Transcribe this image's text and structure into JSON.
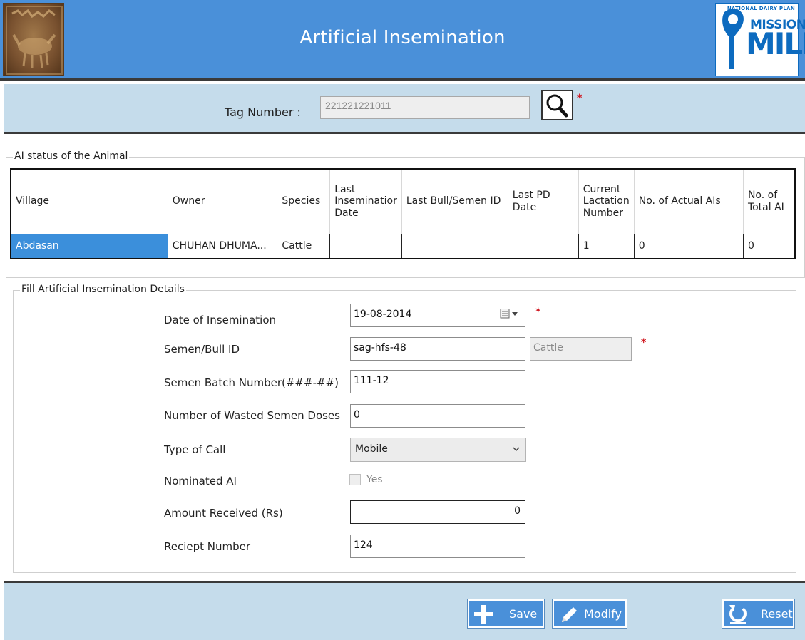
{
  "header": {
    "title": "Artificial Insemination",
    "logo_right": {
      "plan": "NATIONAL DAIRY PLAN",
      "mission": "MISSION",
      "milk": "MILK"
    }
  },
  "tag": {
    "label": "Tag Number :",
    "value": "221221221011"
  },
  "ai_status": {
    "legend": "AI status of the Animal",
    "columns": [
      "Village",
      "Owner",
      "Species",
      "Last Inseminatior Date",
      "Last Bull/Semen ID",
      "Last PD Date",
      "Current Lactation Number",
      "No. of Actual AIs",
      "No. of Total AI"
    ],
    "row": {
      "village": "Abdasan",
      "owner": "CHUHAN   DHUMA...",
      "species": "Cattle",
      "last_insemination_date": "",
      "last_bull_semen_id": "",
      "last_pd_date": "",
      "current_lactation_number": "1",
      "actual_ais": "0",
      "total_ai": "0"
    }
  },
  "details": {
    "legend": "Fill Artificial Insemination Details",
    "date_label": "Date of Insemination",
    "date_value": "19-08-2014",
    "semen_label": "Semen/Bull ID",
    "semen_value": "sag-hfs-48",
    "species_value": "Cattle",
    "batch_label": "Semen Batch Number(###-##)",
    "batch_value": "111-12",
    "wasted_label": "Number of Wasted Semen Doses",
    "wasted_value": "0",
    "call_label": "Type of Call",
    "call_value": "Mobile",
    "nominated_label": "Nominated AI",
    "nominated_option": "Yes",
    "amount_label": "Amount  Received (Rs)",
    "amount_value": "0",
    "receipt_label": "Reciept Number",
    "receipt_value": "124"
  },
  "buttons": {
    "save": "Save",
    "modify": "Modify",
    "reset": "Reset"
  },
  "colors": {
    "header_bg": "#4a90d9",
    "bar_bg": "#c5dceb",
    "selected_cell": "#3b8fdb",
    "required": "#d0141d"
  }
}
